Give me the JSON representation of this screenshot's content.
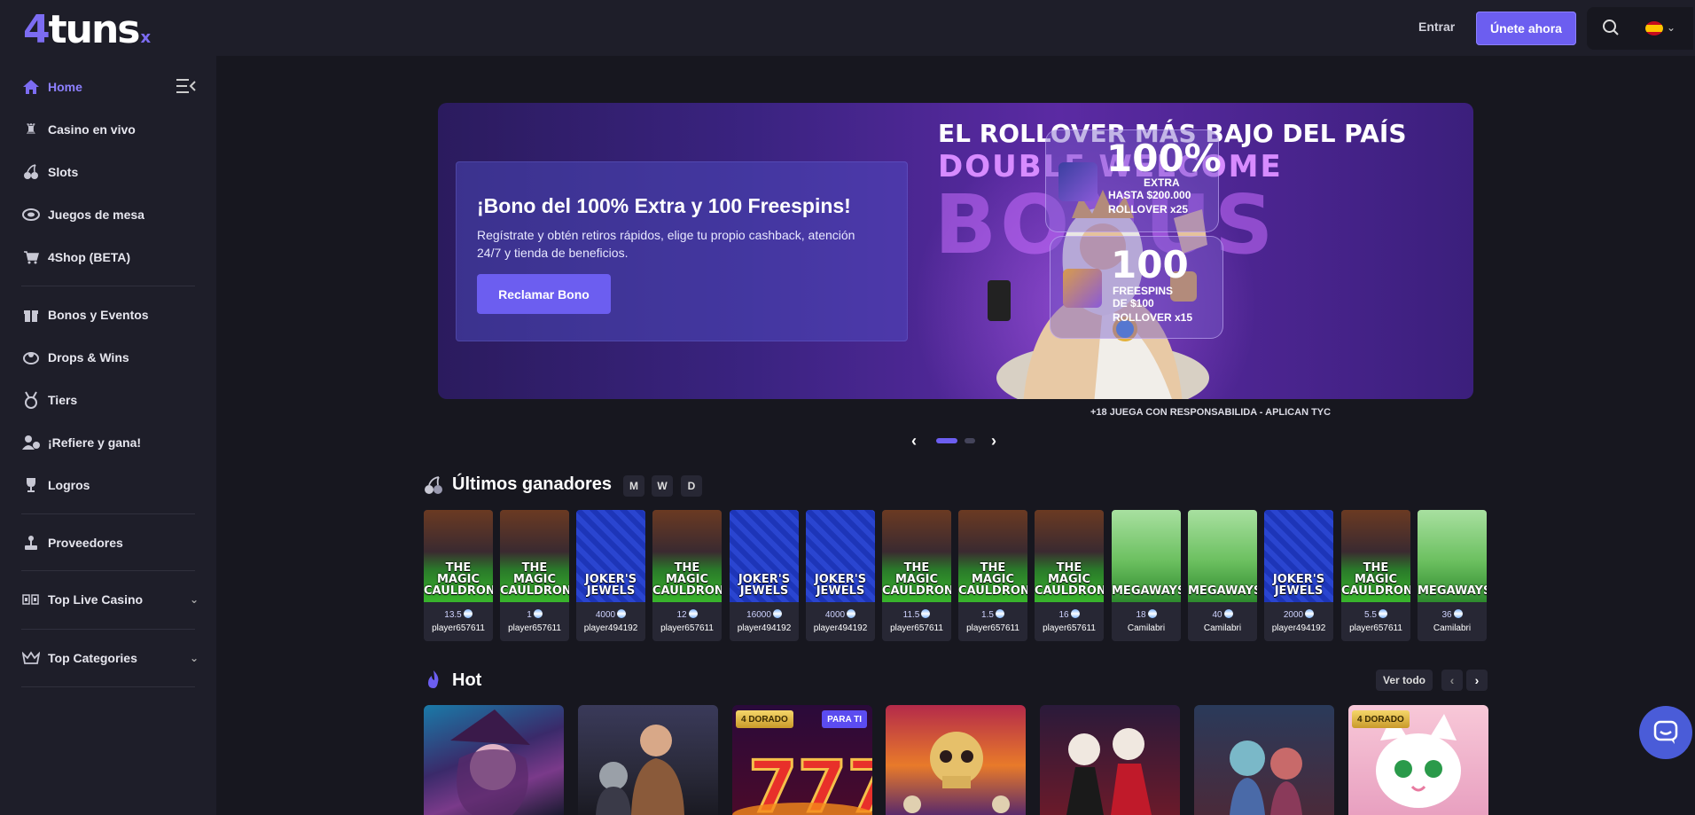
{
  "header": {
    "logo_main": "4tuns",
    "logo_suffix": "x",
    "login_label": "Entrar",
    "join_label": "Únete ahora",
    "search_icon": "search-icon",
    "language_flag": "spain-flag-icon"
  },
  "sidebar": {
    "items": [
      {
        "label": "Home",
        "icon": "home-icon"
      },
      {
        "label": "Casino en vivo",
        "icon": "chess-rook-icon"
      },
      {
        "label": "Slots",
        "icon": "cherries-icon"
      },
      {
        "label": "Juegos de mesa",
        "icon": "chip-icon"
      },
      {
        "label": "4Shop (BETA)",
        "icon": "cart-icon"
      },
      {
        "label": "Bonos y Eventos",
        "icon": "gift-icon"
      },
      {
        "label": "Drops & Wins",
        "icon": "drops-icon"
      },
      {
        "label": "Tiers",
        "icon": "medal-icon"
      },
      {
        "label": "¡Refiere y gana!",
        "icon": "refer-icon"
      },
      {
        "label": "Logros",
        "icon": "trophy-icon"
      },
      {
        "label": "Proveedores",
        "icon": "joystick-icon"
      },
      {
        "label": "Top Live Casino",
        "icon": "cards-icon"
      },
      {
        "label": "Top Categories",
        "icon": "crown-icon"
      }
    ]
  },
  "banner": {
    "promo_title": "¡Bono del 100% Extra y 100 Freespins!",
    "promo_desc": "Regístrate y obtén retiros rápidos, elige tu propio cashback, atención 24/7 y tienda de beneficios.",
    "promo_button": "Reclamar Bono",
    "headline": "EL ROLLOVER MÁS BAJO DEL PAÍS",
    "subheadline": "DOUBLE WELCOME",
    "bonus_word": "BONUS",
    "offer1": {
      "big": "100%",
      "line1": "EXTRA",
      "line2": "HASTA $200.000",
      "line3": "ROLLOVER x25"
    },
    "offer2": {
      "big": "100",
      "line1": "FREESPINS",
      "line2": "DE $100",
      "line3": "ROLLOVER x15"
    },
    "disclaimer": "+18 JUEGA CON RESPONSABILIDA - APLICAN TYC"
  },
  "carousel": {
    "active_index": 0,
    "count": 2
  },
  "winners": {
    "title": "Últimos ganadores",
    "filters": [
      "M",
      "W",
      "D"
    ],
    "items": [
      {
        "game": "cauldron",
        "name": "THE MAGIC CAULDRON",
        "amount": "13.5",
        "user": "player657611"
      },
      {
        "game": "cauldron",
        "name": "THE MAGIC CAULDRON",
        "amount": "1",
        "user": "player657611"
      },
      {
        "game": "jokers",
        "name": "JOKER'S JEWELS",
        "amount": "4000",
        "user": "player494192"
      },
      {
        "game": "cauldron",
        "name": "THE MAGIC CAULDRON",
        "amount": "12",
        "user": "player657611"
      },
      {
        "game": "jokers",
        "name": "JOKER'S JEWELS",
        "amount": "16000",
        "user": "player494192"
      },
      {
        "game": "jokers",
        "name": "JOKER'S JEWELS",
        "amount": "4000",
        "user": "player494192"
      },
      {
        "game": "cauldron",
        "name": "THE MAGIC CAULDRON",
        "amount": "11.5",
        "user": "player657611"
      },
      {
        "game": "cauldron",
        "name": "THE MAGIC CAULDRON",
        "amount": "1.5",
        "user": "player657611"
      },
      {
        "game": "cauldron",
        "name": "THE MAGIC CAULDRON",
        "amount": "16",
        "user": "player657611"
      },
      {
        "game": "megaways",
        "name": "MEGAWAYS",
        "amount": "18",
        "user": "Camilabri"
      },
      {
        "game": "megaways",
        "name": "MEGAWAYS",
        "amount": "40",
        "user": "Camilabri"
      },
      {
        "game": "jokers",
        "name": "JOKER'S JEWELS",
        "amount": "2000",
        "user": "player494192"
      },
      {
        "game": "cauldron",
        "name": "THE MAGIC CAULDRON",
        "amount": "5.5",
        "user": "player657611"
      },
      {
        "game": "megaways",
        "name": "MEGAWAYS",
        "amount": "36",
        "user": "Camilabri"
      }
    ]
  },
  "hot": {
    "title": "Hot",
    "see_all": "Ver todo",
    "cards": [
      {
        "theme": "witch",
        "badges": []
      },
      {
        "theme": "hunter",
        "badges": []
      },
      {
        "theme": "sevens",
        "badges": [
          "4 DORADO",
          "PARA TI"
        ]
      },
      {
        "theme": "skull",
        "badges": []
      },
      {
        "theme": "dia-muertos",
        "badges": []
      },
      {
        "theme": "kids",
        "badges": []
      },
      {
        "theme": "cat",
        "badges": [
          "4 DORADO"
        ]
      }
    ]
  },
  "colors": {
    "accent": "#6c5ef0",
    "background": "#17171f",
    "sidebar": "#1e1e29"
  }
}
